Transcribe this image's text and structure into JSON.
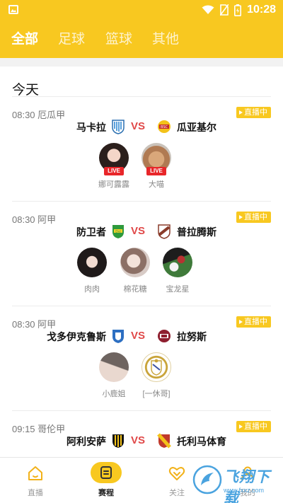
{
  "status_bar": {
    "time": "10:28"
  },
  "tabs": [
    {
      "label": "全部",
      "active": true
    },
    {
      "label": "足球",
      "active": false
    },
    {
      "label": "篮球",
      "active": false
    },
    {
      "label": "其他",
      "active": false
    }
  ],
  "section": {
    "title": "今天"
  },
  "matches": [
    {
      "meta": "08:30 厄瓜甲",
      "badge": "直播中",
      "home": "马卡拉",
      "vs": "VS",
      "away": "瓜亚基尔",
      "anchors": [
        {
          "name": "娜可露露",
          "live": "LIVE"
        },
        {
          "name": "大喵",
          "live": "LIVE"
        }
      ]
    },
    {
      "meta": "08:30 阿甲",
      "badge": "直播中",
      "home": "防卫者",
      "vs": "VS",
      "away": "普拉腾斯",
      "anchors": [
        {
          "name": "肉肉"
        },
        {
          "name": "棉花糖"
        },
        {
          "name": "宝龙星"
        }
      ]
    },
    {
      "meta": "08:30 阿甲",
      "badge": "直播中",
      "home": "戈多伊克鲁斯",
      "vs": "VS",
      "away": "拉努斯",
      "anchors": [
        {
          "name": "小鹿姐"
        },
        {
          "name": "[一休哥]"
        }
      ]
    },
    {
      "meta": "09:15 哥伦甲",
      "badge": "直播中",
      "home": "阿利安萨",
      "vs": "VS",
      "away": "托利马体育"
    }
  ],
  "bottom_nav": [
    {
      "label": "直播",
      "icon": "home-icon",
      "active": false
    },
    {
      "label": "赛程",
      "icon": "schedule-icon",
      "active": true
    },
    {
      "label": "关注",
      "icon": "heart-icon",
      "active": false
    },
    {
      "label": "我的",
      "icon": "profile-icon",
      "active": false
    }
  ],
  "watermark": {
    "text": "飞翔下载",
    "url": "www.fxxz.com"
  },
  "colors": {
    "accent": "#f8c820",
    "vs": "#e04848",
    "live_tag": "#e8262a"
  }
}
